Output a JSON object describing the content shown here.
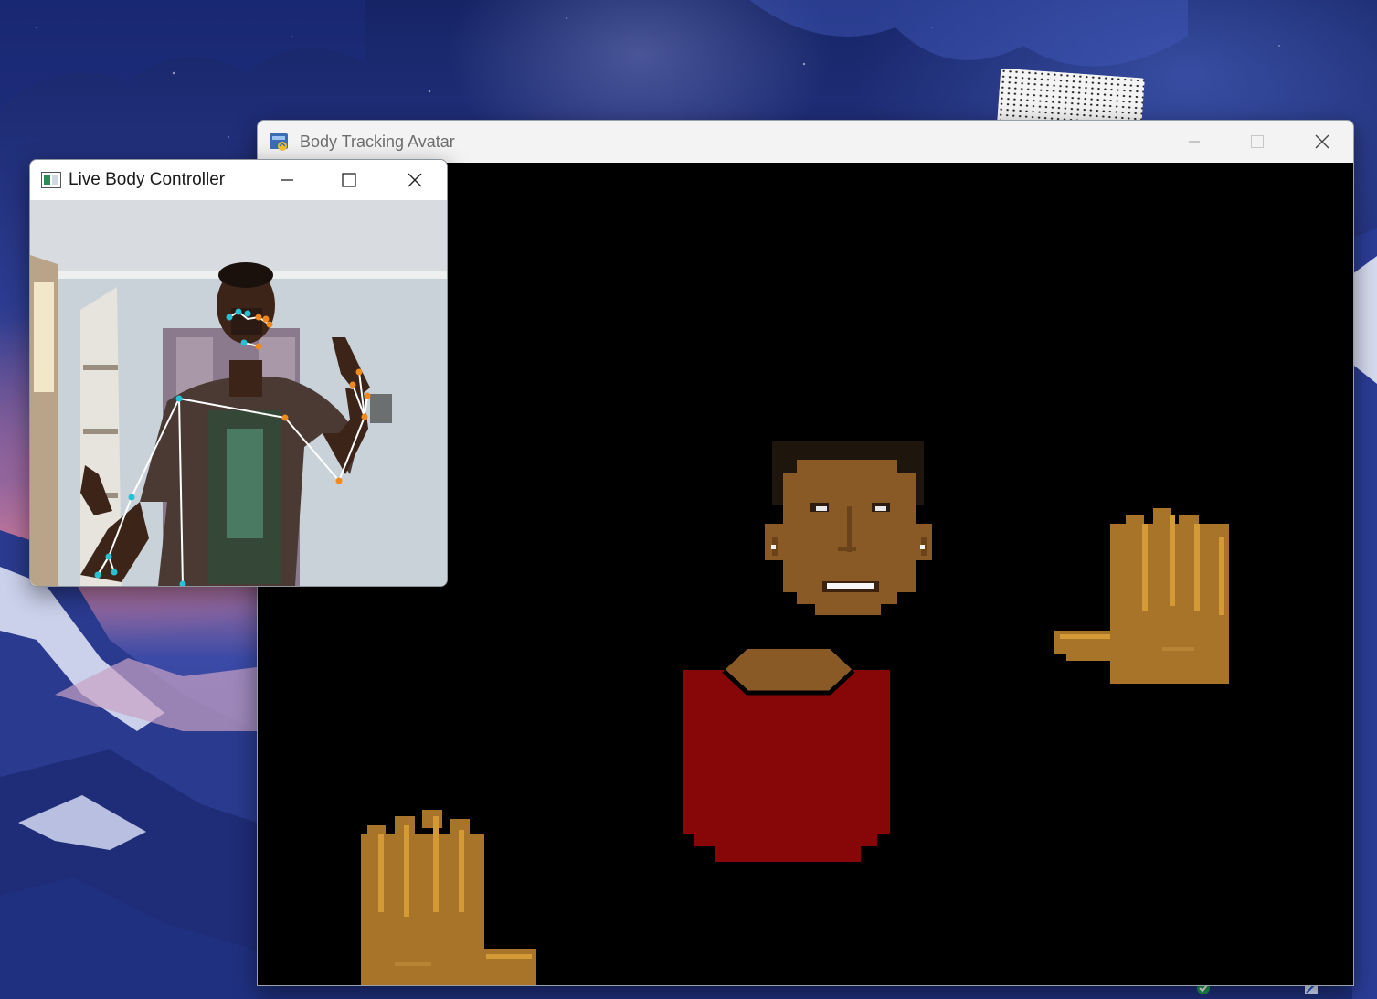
{
  "desktop": {
    "wallpaper": "anime-style night sky over snowy mountains",
    "accent_colors": [
      "#162466",
      "#c77b9c",
      "#2c3b8f"
    ]
  },
  "avatar_window": {
    "title": "Body Tracking Avatar",
    "icon": "python-app-icon",
    "canvas_background": "#000000",
    "controls": {
      "minimize": "minimize-icon",
      "maximize": "maximize-icon",
      "close": "close-icon"
    },
    "avatar_colors": {
      "skin": "#8a5a26",
      "skin_shadow": "#6b431a",
      "hair": "#1e150d",
      "shirt": "#870607",
      "glove": "#a8742a",
      "glove_highlight": "#d39a35"
    }
  },
  "controller_window": {
    "title": "Live Body Controller",
    "icon": "opencv-window-icon",
    "controls": {
      "minimize": "minimize-icon",
      "maximize": "maximize-icon",
      "close": "close-icon"
    },
    "landmark_colors": {
      "left": "#27c1d6",
      "right": "#f08a1c",
      "connections": "#ffffff"
    }
  }
}
